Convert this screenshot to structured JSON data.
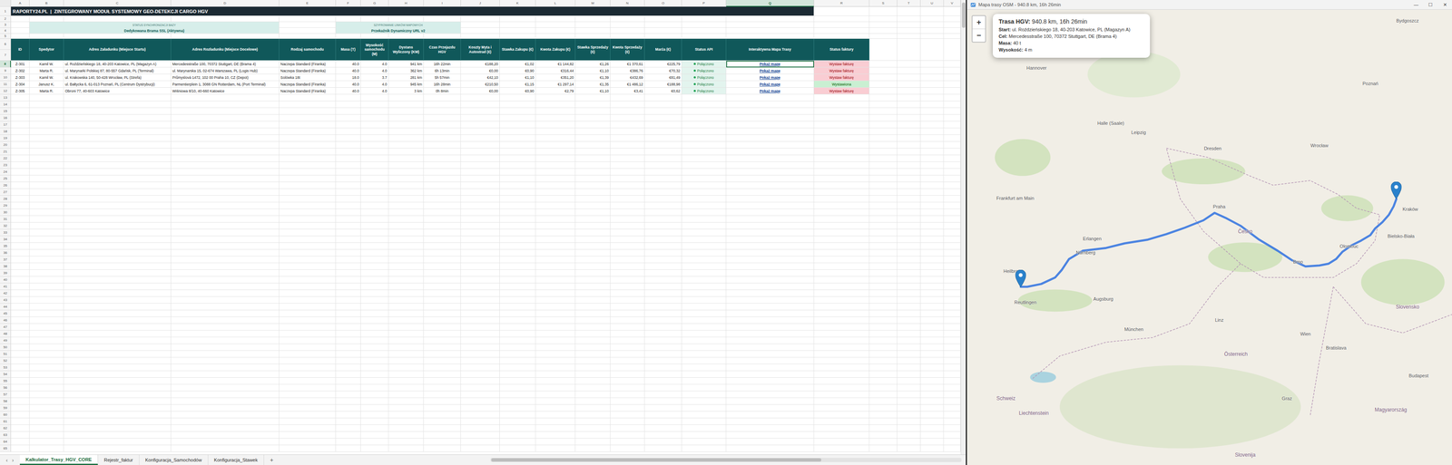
{
  "excel": {
    "column_letters": [
      {
        "label": "A",
        "selected": false
      },
      {
        "label": "B",
        "selected": false
      },
      {
        "label": "C",
        "selected": false
      },
      {
        "label": "D",
        "selected": false
      },
      {
        "label": "E",
        "selected": false
      },
      {
        "label": "F",
        "selected": false
      },
      {
        "label": "G",
        "selected": false
      },
      {
        "label": "H",
        "selected": false
      },
      {
        "label": "I",
        "selected": false
      },
      {
        "label": "J",
        "selected": false
      },
      {
        "label": "K",
        "selected": false
      },
      {
        "label": "L",
        "selected": false
      },
      {
        "label": "M",
        "selected": false
      },
      {
        "label": "N",
        "selected": false
      },
      {
        "label": "O",
        "selected": false
      },
      {
        "label": "P",
        "selected": false
      },
      {
        "label": "Q",
        "selected": true
      },
      {
        "label": "R",
        "selected": false
      },
      {
        "label": "S",
        "selected": false
      },
      {
        "label": "T",
        "selected": false
      },
      {
        "label": "U",
        "selected": false
      },
      {
        "label": "V",
        "selected": false
      }
    ],
    "row_numbers": [
      "1",
      "2",
      "3",
      "4",
      "5",
      "6",
      "7",
      "8",
      "9",
      "10",
      "11",
      "12",
      "13",
      "14",
      "15",
      "16",
      "17",
      "18",
      "19",
      "20",
      "21",
      "22",
      "23",
      "24",
      "25",
      "26",
      "27",
      "28",
      "29",
      "30",
      "31",
      "32",
      "33",
      "34",
      "35",
      "36",
      "37",
      "38",
      "39",
      "40",
      "41",
      "42",
      "43",
      "44",
      "45",
      "46",
      "47",
      "48",
      "49",
      "50",
      "51",
      "52",
      "53",
      "54",
      "55",
      "56",
      "57",
      "58",
      "59",
      "60",
      "61",
      "62",
      "63",
      "64",
      "65"
    ],
    "title": "RAPORTY24.PL  |  ZINTEGROWANY MODUŁ SYSTEMOWY GEO-DETEKCJI CARGO HGV",
    "status_boxes": [
      {
        "label": "STATUS SYNCHRONIZACJI BAZY",
        "value": "Dedykowana Brama SSL (Aktywna)"
      },
      {
        "label": "SZYFROWANIE LINKÓW MAPOWYCH",
        "value": "Przekaźnik Dynamiczny URL v2"
      }
    ],
    "table": {
      "columns": [
        "ID",
        "Spedytor",
        "Adres Załadunku (Miejsce Startu)",
        "Adres Rozładunku (Miejsce Docelowe)",
        "Rodzaj samochodu",
        "Masa (T)",
        "Wysokość samochodu (M)",
        "Dystans Wyliczony (KM)",
        "Czas Przejazdu HGV",
        "Koszty Myta i Autostrad (€)",
        "Stawka Zakupu (€)",
        "Kwota Zakupu (€)",
        "Stawka Sprzedaży (€)",
        "Kwota Sprzedaży (€)",
        "Marża (€)",
        "Status API",
        "Interaktywna Mapa Trasy",
        "Status faktury"
      ],
      "rows": [
        {
          "id": "Z-301",
          "forwarder": "Kamil W.",
          "from": "ul. Roździeńskiego 18, 40-203 Katowice, PL (Magazyn A)",
          "to": "Mercedesstraße 100, 70372 Stuttgart, DE (Brama 4)",
          "vehicle": "Naczepa Standard (Firanka)",
          "mass": "40.0",
          "height": "4.0",
          "distance": "941 km",
          "time": "16h 22min",
          "tolls": "€188,20",
          "buy_rate": "€1,02",
          "buy_amount": "€1 144,82",
          "sell_rate": "€1,26",
          "sell_amount": "€1 370,61",
          "margin": "€225,79",
          "api": {
            "label": "Połączono",
            "connected": true
          },
          "map": {
            "label": "Pokaż mapę",
            "selected": true
          },
          "invoice": {
            "label": "Wystaw fakturę",
            "issued": false
          }
        },
        {
          "id": "Z-302",
          "forwarder": "Marta R.",
          "from": "ul. Marynarki Polskiej 87, 80-557 Gdańsk, PL (Terminal)",
          "to": "ul. Marynarska 15, 02-674 Warszawa, PL (Logis Hub)",
          "vehicle": "Naczepa Standard (Firanka)",
          "mass": "40.0",
          "height": "4.0",
          "distance": "362 km",
          "time": "6h 13min",
          "tolls": "€0,00",
          "buy_rate": "€0,90",
          "buy_amount": "€316,44",
          "sell_rate": "€1,10",
          "sell_amount": "€386,76",
          "margin": "€70,32",
          "api": {
            "label": "Połączono",
            "connected": true
          },
          "map": {
            "label": "Pokaż mapę",
            "selected": false
          },
          "invoice": {
            "label": "Wystaw fakturę",
            "issued": false
          }
        },
        {
          "id": "Z-303",
          "forwarder": "Kamil W.",
          "from": "ul. Krakowska 140, 50-428 Wrocław, PL (Strefa)",
          "to": "Průmyslová 1472, 102 00 Praha 10, CZ (Depot)",
          "vehicle": "Solówka 18t",
          "mass": "18.0",
          "height": "3.7",
          "distance": "281 km",
          "time": "5h 57min",
          "tolls": "€42,10",
          "buy_rate": "€1,10",
          "buy_amount": "€351,20",
          "sell_rate": "€1,39",
          "sell_amount": "€432,69",
          "margin": "€81,49",
          "api": {
            "label": "Połączono",
            "connected": true
          },
          "map": {
            "label": "Pokaż mapę",
            "selected": false
          },
          "invoice": {
            "label": "Wystaw fakturę",
            "issued": false
          }
        },
        {
          "id": "Z-304",
          "forwarder": "Janusz K.",
          "from": "ul. Bałtycka 6, 61-013 Poznań, PL (Centrum Dystrybucji)",
          "to": "Parmentierplein 1, 3088 GN Rotterdam, NL (Port Terminal)",
          "vehicle": "Naczepa Standard (Firanka)",
          "mass": "40.0",
          "height": "4.0",
          "distance": "945 km",
          "time": "16h 28min",
          "tolls": "€210,50",
          "buy_rate": "€1,15",
          "buy_amount": "€1 297,14",
          "sell_rate": "€1,35",
          "sell_amount": "€1 486,12",
          "margin": "€188,98",
          "api": {
            "label": "Połączono",
            "connected": true
          },
          "map": {
            "label": "Pokaż mapę",
            "selected": false
          },
          "invoice": {
            "label": "Wystawiona",
            "issued": true
          }
        },
        {
          "id": "Z-305",
          "forwarder": "Marta R.",
          "from": "Obroni 77, 40-603 Katowice",
          "to": "Wiśniowa 8/10, 40-660 Katowice",
          "vehicle": "Naczepa Standard (Firanka)",
          "mass": "40.0",
          "height": "4.0",
          "distance": "3 km",
          "time": "0h 8min",
          "tolls": "€0,00",
          "buy_rate": "€0,90",
          "buy_amount": "€2,79",
          "sell_rate": "€1,10",
          "sell_amount": "€3,41",
          "margin": "€0,62",
          "api": {
            "label": "Połączono",
            "connected": true
          },
          "map": {
            "label": "Pokaż mapę",
            "selected": false
          },
          "invoice": {
            "label": "Wystaw fakturę",
            "issued": false
          }
        }
      ]
    },
    "sheet_nav": [
      "‹",
      "›"
    ],
    "sheet_tabs": [
      {
        "label": "Kalkulator_Trasy_HGV_CORE",
        "selected": true
      },
      {
        "label": "Rejestr_faktur",
        "selected": false
      },
      {
        "label": "Konfiguracja_Samochodów",
        "selected": false
      },
      {
        "label": "Konfiguracja_Stawek",
        "selected": false
      }
    ],
    "add_sheet": "+"
  },
  "map_window": {
    "title": "Mapa trasy OSM - 940.8 km, 16h 26min",
    "controls": [
      "—",
      "☐",
      "✕"
    ],
    "zoom": [
      "+",
      "−"
    ],
    "popup": {
      "heading": "Trasa HGV:",
      "heading_value": "940.8 km, 16h 26min",
      "lines": [
        {
          "label": "Start:",
          "value": "ul. Roździeńskiego 18, 40-203 Katowice, PL (Magazyn A)"
        },
        {
          "label": "Cel:",
          "value": "Mercedesstraße 100, 70372 Stuttgart, DE (Brama 4)"
        },
        {
          "label": "Masa:",
          "value": "40 t"
        },
        {
          "label": "Wysokość:",
          "value": "4 m"
        }
      ]
    },
    "labels": [
      {
        "text": "Bydgoszcz",
        "kind": "city"
      },
      {
        "text": "Hannover",
        "kind": "city"
      },
      {
        "text": "Poznań",
        "kind": "city"
      },
      {
        "text": "Halle (Saale)",
        "kind": "city"
      },
      {
        "text": "Leipzig",
        "kind": "city"
      },
      {
        "text": "Dresden",
        "kind": "city"
      },
      {
        "text": "Wrocław",
        "kind": "city"
      },
      {
        "text": "Frankfurt am Main",
        "kind": "city"
      },
      {
        "text": "Praha",
        "kind": "city"
      },
      {
        "text": "Česko",
        "kind": "country"
      },
      {
        "text": "Erlangen",
        "kind": "city"
      },
      {
        "text": "Nürnberg",
        "kind": "city"
      },
      {
        "text": "Kraków",
        "kind": "city"
      },
      {
        "text": "Bielsko-Biała",
        "kind": "city"
      },
      {
        "text": "Olomouc",
        "kind": "city"
      },
      {
        "text": "Brno",
        "kind": "city"
      },
      {
        "text": "Heilbronn",
        "kind": "city"
      },
      {
        "text": "Reutlingen",
        "kind": "city"
      },
      {
        "text": "Augsburg",
        "kind": "city"
      },
      {
        "text": "München",
        "kind": "city"
      },
      {
        "text": "Linz",
        "kind": "city"
      },
      {
        "text": "Wien",
        "kind": "city"
      },
      {
        "text": "Bratislava",
        "kind": "city"
      },
      {
        "text": "Slovensko",
        "kind": "country"
      },
      {
        "text": "Österreich",
        "kind": "country"
      },
      {
        "text": "Budapest",
        "kind": "city"
      },
      {
        "text": "Magyarország",
        "kind": "country"
      },
      {
        "text": "Schweiz",
        "kind": "country"
      },
      {
        "text": "Liechtenstein",
        "kind": "country"
      },
      {
        "text": "Graz",
        "kind": "city"
      },
      {
        "text": "Slovenija",
        "kind": "country"
      }
    ]
  }
}
